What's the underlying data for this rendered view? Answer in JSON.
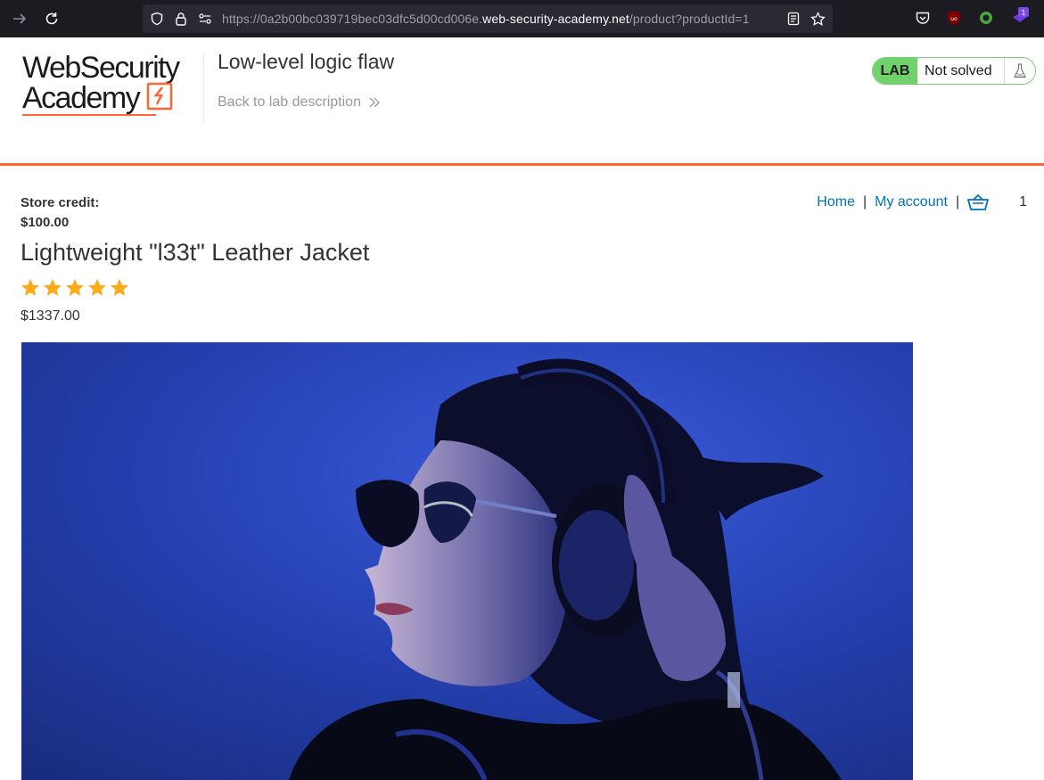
{
  "browser": {
    "url_prefix": "https://0a2b00bc039719bec03dfc5d00cd006e.",
    "url_domain": "web-security-academy.net",
    "url_path": "/product?productId=1",
    "extension_badge": "1"
  },
  "lab_header": {
    "logo_line1": "WebSecurity",
    "logo_line2": "Academy",
    "title": "Low-level logic flaw",
    "back_link": "Back to lab description",
    "status_badge": "LAB",
    "status_text": "Not solved"
  },
  "account": {
    "credit_label": "Store credit:",
    "credit_value": "$100.00"
  },
  "nav": {
    "home": "Home",
    "my_account": "My account",
    "cart_count": "1"
  },
  "product": {
    "title": "Lightweight \"l33t\" Leather Jacket",
    "rating": 5,
    "price": "$1337.00"
  },
  "colors": {
    "accent_orange": "#ff6633",
    "link_blue": "#0071bc",
    "lab_green": "#70d16d",
    "star": "#fbaa1a"
  }
}
